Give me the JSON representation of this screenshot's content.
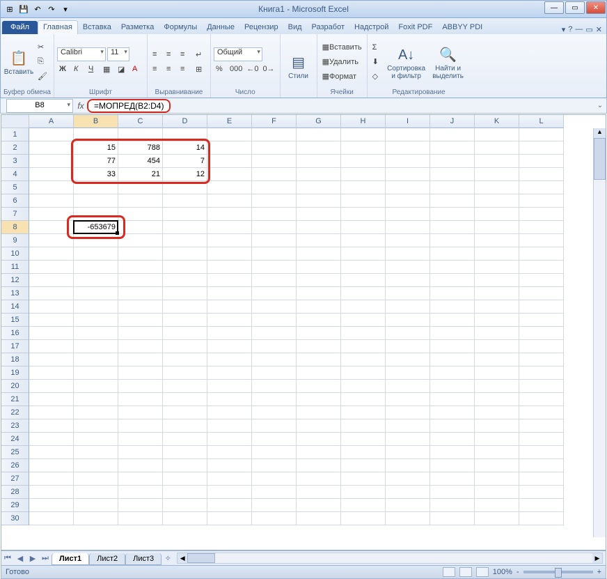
{
  "window": {
    "title": "Книга1 - Microsoft Excel"
  },
  "tabs": {
    "file": "Файл",
    "items": [
      "Главная",
      "Вставка",
      "Разметка",
      "Формулы",
      "Данные",
      "Рецензир",
      "Вид",
      "Разработ",
      "Надстрой",
      "Foxit PDF",
      "ABBYY PDI"
    ],
    "active": 0
  },
  "ribbon": {
    "clipboard": {
      "paste": "Вставить",
      "label": "Буфер обмена"
    },
    "font": {
      "name": "Calibri",
      "size": "11",
      "label": "Шрифт"
    },
    "alignment": {
      "label": "Выравнивание"
    },
    "number": {
      "format": "Общий",
      "label": "Число"
    },
    "styles": {
      "btn": "Стили",
      "label": ""
    },
    "cells": {
      "insert": "Вставить",
      "delete": "Удалить",
      "format": "Формат",
      "label": "Ячейки"
    },
    "editing": {
      "sort": "Сортировка и фильтр",
      "find": "Найти и выделить",
      "label": "Редактирование"
    }
  },
  "formula_bar": {
    "name_box": "B8",
    "formula": "=МОПРЕД(B2:D4)"
  },
  "grid": {
    "columns": [
      "A",
      "B",
      "C",
      "D",
      "E",
      "F",
      "G",
      "H",
      "I",
      "J",
      "K",
      "L"
    ],
    "rows": 30,
    "active_row": 8,
    "active_col": "B",
    "data": {
      "2": {
        "B": "15",
        "C": "788",
        "D": "14"
      },
      "3": {
        "B": "77",
        "C": "454",
        "D": "7"
      },
      "4": {
        "B": "33",
        "C": "21",
        "D": "12"
      },
      "8": {
        "B": "-653679"
      }
    }
  },
  "sheets": {
    "items": [
      "Лист1",
      "Лист2",
      "Лист3"
    ],
    "active": 0
  },
  "status": {
    "ready": "Готово",
    "zoom": "100%",
    "minus": "-",
    "plus": "+"
  },
  "icons": {
    "excel": "⊞",
    "save": "💾",
    "undo": "↶",
    "redo": "↷",
    "dd": "▾",
    "min": "—",
    "max": "▭",
    "close": "✕",
    "cut": "✂",
    "copy": "⎘",
    "brush": "🖌",
    "bold": "Ж",
    "italic": "К",
    "underline": "Ч",
    "border": "▦",
    "fill": "◪",
    "fontcolor": "A",
    "al": "≡",
    "wrap": "↵",
    "merge": "⊞",
    "pct": "%",
    "comma": "000",
    "dec_inc": "←0",
    "dec_dec": "0→",
    "sigma": "Σ",
    "filldown": "⬇",
    "clear": "◇",
    "sort": "A↓",
    "find": "🔍",
    "help": "?",
    "caret": "▾"
  }
}
